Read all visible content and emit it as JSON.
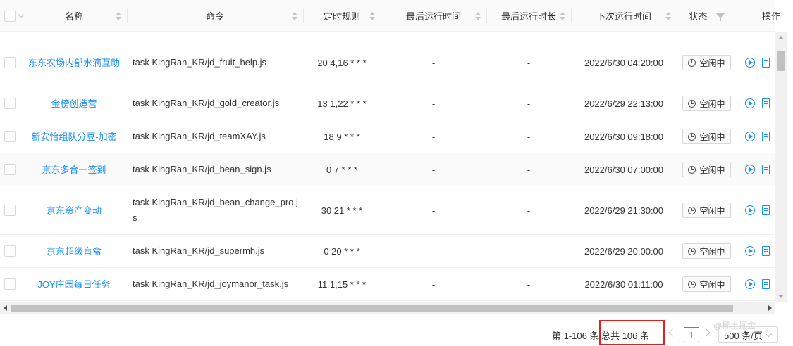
{
  "header": {
    "name": "名称",
    "command": "命令",
    "schedule": "定时规则",
    "last_run_time": "最后运行时间",
    "last_run_duration": "最后运行时长",
    "next_run_time": "下次运行时间",
    "status": "状态",
    "actions": "操作"
  },
  "rows": [
    {
      "name": "东东农场内部水滴互助",
      "command": "task KingRan_KR/jd_fruit_help.js",
      "schedule": "20 4,16 * * *",
      "last_run": "-",
      "duration": "-",
      "next_run": "2022/6/30 04:20:00",
      "status": "空闲中"
    },
    {
      "name": "金榜创造营",
      "command": "task KingRan_KR/jd_gold_creator.js",
      "schedule": "13 1,22 * * *",
      "last_run": "-",
      "duration": "-",
      "next_run": "2022/6/29 22:13:00",
      "status": "空闲中"
    },
    {
      "name": "新安怡组队分豆-加密",
      "command": "task KingRan_KR/jd_teamXAY.js",
      "schedule": "18 9 * * *",
      "last_run": "-",
      "duration": "-",
      "next_run": "2022/6/30 09:18:00",
      "status": "空闲中"
    },
    {
      "name": "京东多合一签到",
      "command": "task KingRan_KR/jd_bean_sign.js",
      "schedule": "0 7 * * *",
      "last_run": "-",
      "duration": "-",
      "next_run": "2022/6/30 07:00:00",
      "status": "空闲中"
    },
    {
      "name": "京东资产变动",
      "command": "task KingRan_KR/jd_bean_change_pro.js",
      "schedule": "30 21 * * *",
      "last_run": "-",
      "duration": "-",
      "next_run": "2022/6/29 21:30:00",
      "status": "空闲中"
    },
    {
      "name": "京东超级盲盒",
      "command": "task KingRan_KR/jd_supermh.js",
      "schedule": "0 20 * * *",
      "last_run": "-",
      "duration": "-",
      "next_run": "2022/6/29 20:00:00",
      "status": "空闲中"
    },
    {
      "name": "JOY庄园每日任务",
      "command": "task KingRan_KR/jd_joymanor_task.js",
      "schedule": "11 1,15 * * *",
      "last_run": "-",
      "duration": "-",
      "next_run": "2022/6/30 01:11:00",
      "status": "空闲中"
    }
  ],
  "pagination": {
    "range_text": "第 1-106 条/总共 106 条",
    "current_page": "1",
    "page_size": "500 条/页"
  },
  "watermark": "@稀土掘金",
  "colors": {
    "link": "#1890ff",
    "highlight_box": "#e02020"
  }
}
